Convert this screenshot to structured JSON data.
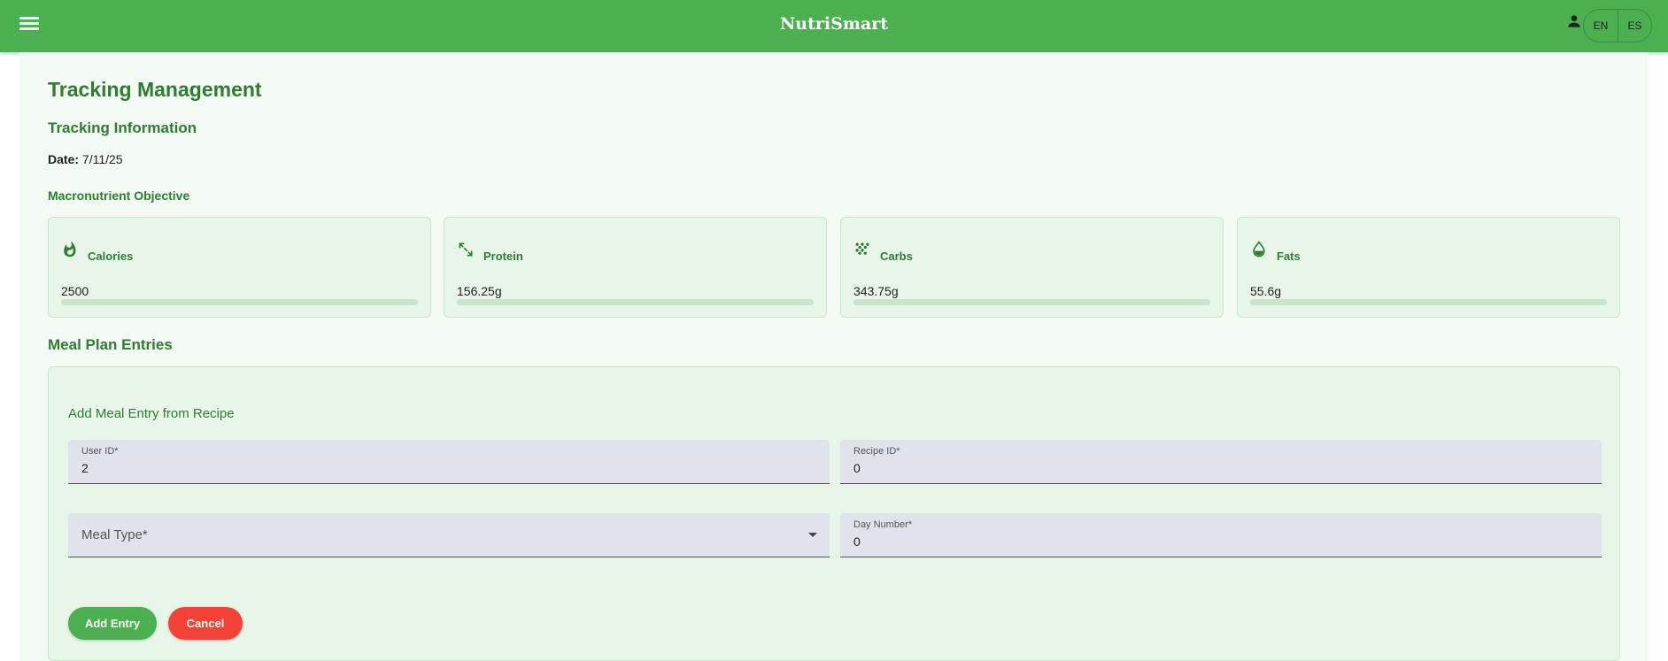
{
  "header": {
    "brand": "NutriSmart",
    "languages": [
      "EN",
      "ES"
    ]
  },
  "page": {
    "title": "Tracking Management",
    "section_title": "Tracking Information",
    "date_label": "Date:",
    "date_value": "7/11/25",
    "macro_title": "Macronutrient Objective",
    "entries_title": "Meal Plan Entries"
  },
  "macros": [
    {
      "label": "Calories",
      "value": "2500",
      "icon": "flame-icon",
      "progress": 0
    },
    {
      "label": "Protein",
      "value": "156.25g",
      "icon": "fitness-icon",
      "progress": 0
    },
    {
      "label": "Carbs",
      "value": "343.75g",
      "icon": "grain-icon",
      "progress": 0
    },
    {
      "label": "Fats",
      "value": "55.6g",
      "icon": "drop-icon",
      "progress": 0
    }
  ],
  "form": {
    "subtitle": "Add Meal Entry from Recipe",
    "user_id": {
      "label": "User ID*",
      "value": "2"
    },
    "recipe_id": {
      "label": "Recipe ID*",
      "value": "0"
    },
    "meal_type": {
      "label": "Meal Type*",
      "value": ""
    },
    "day_number": {
      "label": "Day Number*",
      "value": "0"
    },
    "add_label": "Add Entry",
    "cancel_label": "Cancel"
  },
  "colors": {
    "primary": "#4caf50",
    "primary_dark": "#2e7d32",
    "card_bg": "#e8f5e9",
    "danger": "#f44336",
    "field_bg": "#e0e3ec"
  }
}
